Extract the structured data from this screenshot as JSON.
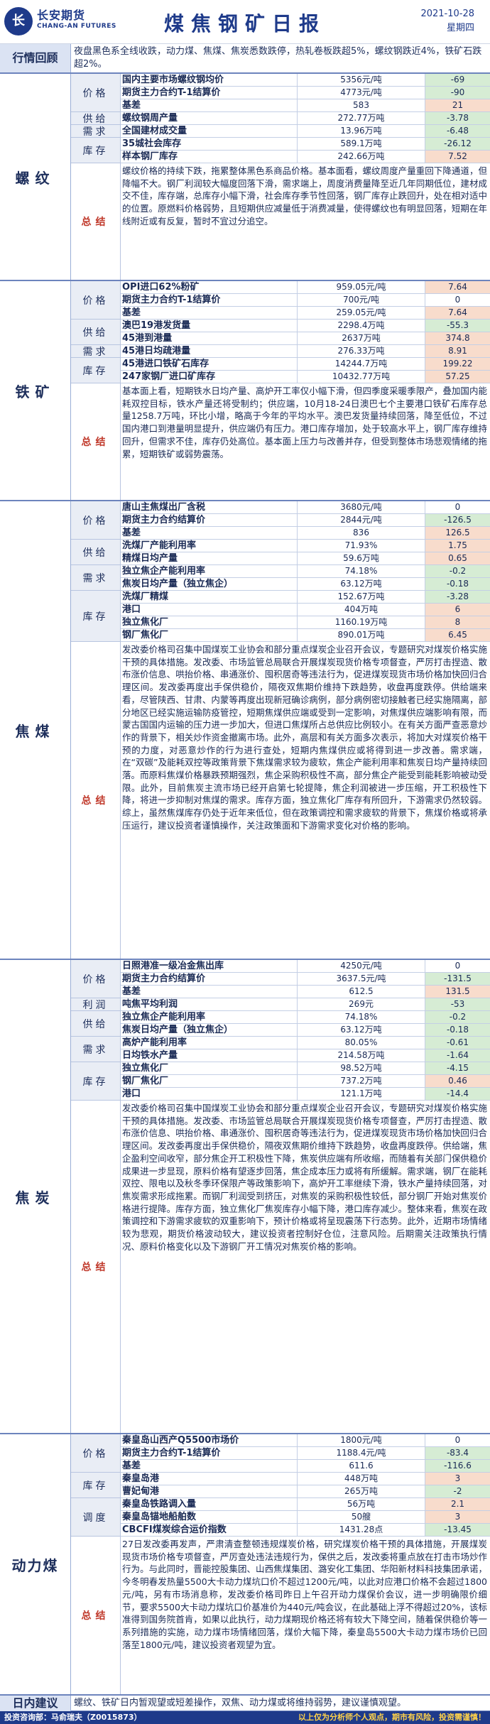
{
  "header": {
    "logo_cn": "长安期货",
    "logo_en": "CHANG-AN FUTURES",
    "logo_mark": "长",
    "title": "煤焦钢矿日报",
    "date": "2021-10-28",
    "weekday": "星期四"
  },
  "review": {
    "label": "行情回顾",
    "text": "夜盘黑色系全线收跌，动力煤、焦煤、焦炭悉数跌停，热轧卷板跌超5%，螺纹钢跌近4%，铁矿石跌超2%。"
  },
  "colors": {
    "accent": "#1e3a8a",
    "up_bg": "#f8dccc",
    "down_bg": "#d6ecd4",
    "summary_label": "#c0392b"
  },
  "sections": {
    "rebar": {
      "label": "螺纹",
      "cats": [
        "价格",
        "供给",
        "需求",
        "库存",
        "总结"
      ],
      "rows": [
        {
          "name": "国内主要市场螺纹钢均价",
          "value": "5356元/吨",
          "change": "-69"
        },
        {
          "name": "期货主力合约T-1结算价",
          "value": "4773元/吨",
          "change": "-90"
        },
        {
          "name": "基差",
          "value": "583",
          "change": "21"
        },
        {
          "name": "螺纹钢周产量",
          "value": "272.77万吨",
          "change": "-3.78"
        },
        {
          "name": "全国建材成交量",
          "value": "13.96万吨",
          "change": "-6.48"
        },
        {
          "name": "35城社会库存",
          "value": "589.1万吨",
          "change": "-26.12"
        },
        {
          "name": "样本钢厂库存",
          "value": "242.66万吨",
          "change": "7.52"
        }
      ],
      "summary": "螺纹价格的持续下跌，拖累整体黑色系商品价格。基本面看，螺纹周度产量重回下降通道，但降幅不大。钢厂利润较大幅度回落下滑，需求端上，周度消费量降至近几年同期低位，建材成交不佳，库存端，总库存小幅下滑，社会库存季节性回落，钢厂库存止跌回升，处在相对适中的位置。原燃料价格弱势，且短期供应减量低于消费减量，使得螺纹也有明显回落，短期在年线附近或有反复，暂时不宜过分追空。"
    },
    "ore": {
      "label": "铁矿",
      "cats": [
        "价格",
        "供给",
        "需求",
        "库存",
        "总结"
      ],
      "rows": [
        {
          "name": "OPI进口62%粉矿",
          "value": "959.05元/吨",
          "change": "7.64"
        },
        {
          "name": "期货主力合约T-1结算价",
          "value": "700元/吨",
          "change": "0"
        },
        {
          "name": "基差",
          "value": "259.05元/吨",
          "change": "7.64"
        },
        {
          "name": "澳巴19港发货量",
          "value": "2298.4万吨",
          "change": "-55.3"
        },
        {
          "name": "45港到港量",
          "value": "2637万吨",
          "change": "374.8"
        },
        {
          "name": "45港日均疏港量",
          "value": "276.33万吨",
          "change": "8.91"
        },
        {
          "name": "45港进口铁矿石库存",
          "value": "14244.7万吨",
          "change": "199.22"
        },
        {
          "name": "247家钢厂进口矿库存",
          "value": "10432.77万吨",
          "change": "57.25"
        }
      ],
      "summary": "基本面上看，短期铁水日均产量、高炉开工率仅小幅下滑，但四季度采暖季限产，叠加国内能耗双控目标，铁水产量还将受制约；供应端，10月18-24日澳巴七个主要港口铁矿石库存总量1258.7万吨，环比小增，略高于今年的平均水平。澳巴发货量持续回落，降至低位，不过国内港口到港量明显提升，供应端仍有压力。港口库存增加，处于较高水平上，钢厂库存维持回升，但需求不佳，库存仍处高位。基本面上压力与改善并存，但受到整体市场悲观情绪的拖累，短期铁矿或弱势震荡。"
    },
    "coking_coal": {
      "label": "焦煤",
      "cats": [
        "价格",
        "供给",
        "需求",
        "库存",
        "总结"
      ],
      "rows": [
        {
          "name": "唐山主焦煤出厂含税",
          "value": "3680元/吨",
          "change": "0"
        },
        {
          "name": "期货主力合约结算价",
          "value": "2844元/吨",
          "change": "-126.5"
        },
        {
          "name": "基差",
          "value": "836",
          "change": "126.5"
        },
        {
          "name": "洗煤厂产能利用率",
          "value": "71.93%",
          "change": "1.75"
        },
        {
          "name": "精煤日均产量",
          "value": "59.6万吨",
          "change": "0.65"
        },
        {
          "name": "独立焦企产能利用率",
          "value": "74.18%",
          "change": "-0.2"
        },
        {
          "name": "焦炭日均产量（独立焦企）",
          "value": "63.12万吨",
          "change": "-0.18"
        },
        {
          "name": "洗煤厂精煤",
          "value": "152.67万吨",
          "change": "-3.28"
        },
        {
          "name": "港口",
          "value": "404万吨",
          "change": "6"
        },
        {
          "name": "独立焦化厂",
          "value": "1160.19万吨",
          "change": "8"
        },
        {
          "name": "钢厂焦化厂",
          "value": "890.01万吨",
          "change": "6.45"
        }
      ],
      "summary": "发改委价格司召集中国煤炭工业协会和部分重点煤炭企业召开会议，专题研究对煤炭价格实施干预的具体措施。发改委、市场监管总局联合开展煤炭现货价格专项督查，严厉打击捏造、散布涨价信息、哄抬价格、串通涨价、囤积居奇等违法行为，促进煤炭现货市场价格加快回归合理区间。发改委再度出手保供稳价，隔夜双焦期价维持下跌趋势，收盘再度跌停。供给端来看，尽管陕西、甘肃、内蒙等再度出现新冠确诊病例，部分病例密切接触者已经实施隔离，部分地区已经实施运输防疫管控，短期焦煤供应端或受到一定影响，对焦煤供应端影响有限，而蒙古国国内运输的压力进一步加大，但进口焦煤所占总供应比例较小。在有关方面严查恶意炒作的背景下，相关炒作资金撤离市场。此外，高层和有关方面多次表示，将加大对煤炭价格干预的力度，对恶意炒作的行为进行查处，短期内焦煤供应或将得到进一步改善。需求端，在“双碳”及能耗双控等政策背景下焦煤需求较为疲软，焦企产能利用率和焦炭日均产量持续回落。而原料焦煤价格暴跌预期强烈，焦企采购积极性不高，部分焦企产能受到能耗影响被动受限。此外，目前焦炭主流市场已经开启第七轮提降，焦企利润被进一步压缩，开工积极性下降，将进一步抑制对焦煤的需求。库存方面，独立焦化厂库存有所回升，下游需求仍然较弱。综上，虽然焦煤库存仍处于近年来低位，但在政策调控和需求疲软的背景下，焦煤价格或将承压运行，建议投资者谨慎操作，关注政策面和下游需求变化对价格的影响。"
    },
    "coke": {
      "label": "焦炭",
      "cats": [
        "价格",
        "利润",
        "供给",
        "需求",
        "库存",
        "总结"
      ],
      "rows": [
        {
          "name": "日照港准一级冶金焦出库",
          "value": "4250元/吨",
          "change": "0"
        },
        {
          "name": "期货主力合约结算价",
          "value": "3637.5元/吨",
          "change": "-131.5"
        },
        {
          "name": "基差",
          "value": "612.5",
          "change": "131.5"
        },
        {
          "name": "吨焦平均利润",
          "value": "269元",
          "change": "-53"
        },
        {
          "name": "独立焦企产能利用率",
          "value": "74.18%",
          "change": "-0.2"
        },
        {
          "name": "焦炭日均产量（独立焦企）",
          "value": "63.12万吨",
          "change": "-0.18"
        },
        {
          "name": "高炉产能利用率",
          "value": "80.05%",
          "change": "-0.61"
        },
        {
          "name": "日均铁水产量",
          "value": "214.58万吨",
          "change": "-1.64"
        },
        {
          "name": "独立焦化厂",
          "value": "98.52万吨",
          "change": "-4.15"
        },
        {
          "name": "钢厂焦化厂",
          "value": "737.2万吨",
          "change": "0.46"
        },
        {
          "name": "港口",
          "value": "121.1万吨",
          "change": "-14.4"
        }
      ],
      "summary": "发改委价格司召集中国煤炭工业协会和部分重点煤炭企业召开会议，专题研究对煤炭价格实施干预的具体措施。发改委、市场监管总局联合开展煤炭现货价格专项督查，严厉打击捏造、散布涨价信息、哄抬价格、串通涨价、囤积居奇等违法行为，促进煤炭现货市场价格加快回归合理区间。发改委再度出手保供稳价，隔夜双焦期价维持下跌趋势，收盘再度跌停。供给端，焦企盈利空间收窄，部分焦企开工积极性下降，焦炭供应端有所收缩，而随着有关部门保供稳价成果进一步显现，原料价格有望逐步回落，焦企成本压力或将有所缓解。需求端，钢厂在能耗双控、限电以及秋冬季环保限产等政策影响下，高炉开工率继续下滑，铁水产量持续回落，对焦炭需求形成拖累。而钢厂利润受到挤压，对焦炭的采购积极性较低，部分钢厂开始对焦炭价格进行提降。库存方面，独立焦化厂焦炭库存小幅下降，港口库存减少。整体来看，焦炭在政策调控和下游需求疲软的双重影响下，预计价格或将呈现震荡下行态势。此外，近期市场情绪较为悲观，期货价格波动较大，建议投资者控制好仓位，注意风险。后期需关注政策执行情况、原料价格变化以及下游钢厂开工情况对焦炭价格的影响。"
    },
    "thermal_coal": {
      "label": "动力煤",
      "cats": [
        "价格",
        "库存",
        "调度",
        "总结"
      ],
      "rows": [
        {
          "name": "秦皇岛山西产Q5500市场价",
          "value": "1800元/吨",
          "change": "0"
        },
        {
          "name": "期货主力合约T-1结算价",
          "value": "1188.4元/吨",
          "change": "-83.4"
        },
        {
          "name": "基差",
          "value": "611.6",
          "change": "-116.6"
        },
        {
          "name": "秦皇岛港",
          "value": "448万吨",
          "change": "3"
        },
        {
          "name": "曹妃甸港",
          "value": "265万吨",
          "change": "-2"
        },
        {
          "name": "秦皇岛铁路调入量",
          "value": "56万吨",
          "change": "2.1"
        },
        {
          "name": "秦皇岛锚地船舶数",
          "value": "50艘",
          "change": "3"
        },
        {
          "name": "CBCFI煤炭综合运价指数",
          "value": "1431.28点",
          "change": "-13.45"
        }
      ],
      "summary": "27日发改委再发声，严肃清查整顿违规煤炭价格，研究煤炭价格干预的具体措施，开展煤炭现货市场价格专项督查，严厉查处违法违规行为，保供之后，发改委将重点放在打击市场炒作行为。与此同时，晋能控股集团、山西焦煤集团、潞安化工集团、华阳新材料科技集团承诺，今冬明春发热量5500大卡动力煤坑口价不超过1200元/吨，以此对应港口价格不会超过1800元/吨，另有市场消息称，发改委价格司昨日上午召开动力煤保价会议，进一步明确限价细节，要求5500大卡动力煤坑口价基准价为440元/吨会议，在此基础上浮不得超过20%，该标准得到国务院首肯，如果以此执行，动力煤期现价格还将有较大下降空间，随着保供稳价等一系列措施的实施，动力煤市场情绪回落，煤价大幅下降，秦皇岛5500大卡动力煤市场价已回落至1800元/吨，建议投资者观望为宜。"
    }
  },
  "daily": {
    "label": "日内建议",
    "text": "螺纹、铁矿日内暂观望或短差操作，双焦、动力煤或将维持弱势，建议谨慎观望。"
  },
  "footer": {
    "left": "投资咨询部：马俞瑞夫（Z0015873）",
    "right": "以上仅为分析师个人观点，期市有风险，投资需谨慎！"
  }
}
